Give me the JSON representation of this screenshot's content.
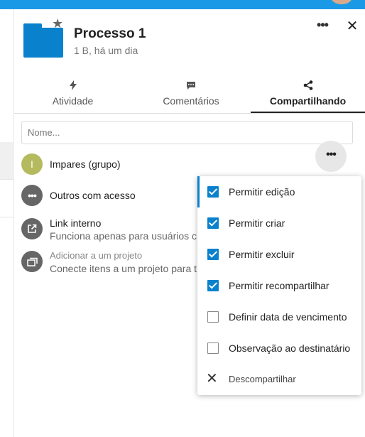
{
  "header": {
    "title": "Processo 1",
    "subtitle": "1 B, há um dia",
    "more_icon": "more-horizontal-icon",
    "close_icon": "close-icon",
    "folder_icon": "folder-icon",
    "favorite_icon": "star-icon"
  },
  "tabs": [
    {
      "label": "Atividade",
      "icon": "lightning-icon"
    },
    {
      "label": "Comentários",
      "icon": "comment-icon"
    },
    {
      "label": "Compartilhando",
      "icon": "share-icon",
      "active": true
    }
  ],
  "search": {
    "placeholder": "Nome...",
    "value": ""
  },
  "shares": [
    {
      "avatar_letter": "I",
      "avatar_color": "#b5ba5f",
      "label": "Impares (grupo)"
    },
    {
      "label": "Outros com acesso"
    },
    {
      "label": "Link interno",
      "sublabel": "Funciona apenas para usuários c"
    },
    {
      "tiny": "Adicionar a um projeto",
      "sublabel": "Conecte itens a um projeto para t"
    }
  ],
  "menu": {
    "items": [
      {
        "label": "Permitir edição",
        "checked": true
      },
      {
        "label": "Permitir criar",
        "checked": true
      },
      {
        "label": "Permitir excluir",
        "checked": true
      },
      {
        "label": "Permitir recompartilhar",
        "checked": true
      },
      {
        "label": "Definir data de vencimento",
        "checked": false
      },
      {
        "label": "Observação ao destinatário",
        "checked": false
      },
      {
        "label": "Descompartilhar",
        "icon": "close-icon"
      }
    ]
  },
  "colors": {
    "accent": "#0a81cc",
    "topbar": "#1a9ae6",
    "icon_gray": "#666666"
  }
}
